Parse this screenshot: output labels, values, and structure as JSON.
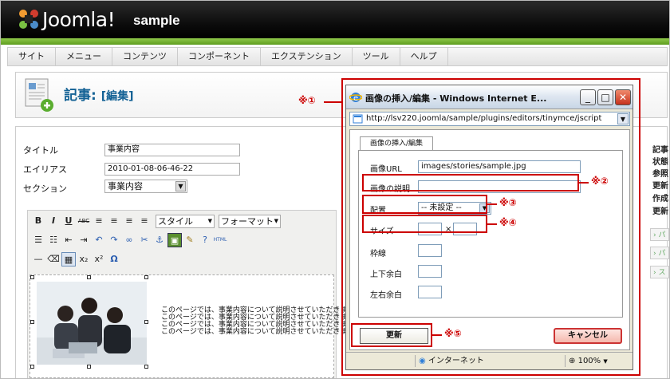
{
  "header": {
    "brand": "Joomla!",
    "site_name": "sample"
  },
  "menu": [
    "サイト",
    "メニュー",
    "コンテンツ",
    "コンポーネント",
    "エクステンション",
    "ツール",
    "ヘルプ"
  ],
  "page": {
    "title": "記事:",
    "subtitle": "[編集]"
  },
  "form": {
    "title_label": "タイトル",
    "title_value": "事業内容",
    "alias_label": "エイリアス",
    "alias_value": "2010-01-08-06-46-22",
    "section_label": "セクション",
    "section_value": "事業内容"
  },
  "editor": {
    "style_select": "スタイル",
    "format_select": "フォーマット",
    "body_lines": [
      "このページでは、事業内容について説明させていただきます。",
      "このページでは、事業内容について説明させていただきます。",
      "このページでは、事業内容について説明させていただきます。",
      "このページでは、事業内容について説明させていただきます。"
    ]
  },
  "right_panel": {
    "labels": [
      "記事",
      "状態",
      "参照",
      "更新",
      "作成",
      "更新"
    ],
    "buttons": [
      "パ",
      "パ",
      "ス"
    ]
  },
  "dialog": {
    "window_title": "画像の挿入/編集 - Windows Internet E...",
    "address": "http://lsv220.joomla/sample/plugins/editors/tinymce/jscript",
    "tab_label": "画像の挿入/編集",
    "url_label": "画像URL",
    "url_value": "images/stories/sample.jpg",
    "desc_label": "画像の説明",
    "desc_value": "",
    "align_label": "配置",
    "align_value": "-- 未設定 --",
    "size_label": "サイズ",
    "size_separator": "×",
    "border_label": "枠線",
    "vspace_label": "上下余白",
    "hspace_label": "左右余白",
    "update_button": "更新",
    "cancel_button": "キャンセル",
    "status_zone": "インターネット",
    "zoom": "100%"
  },
  "callouts": {
    "c1": "※①",
    "c2": "※②",
    "c3": "※③",
    "c4": "※④",
    "c5": "※⑤"
  },
  "colors": {
    "callout_red": "#cc0000",
    "joomla_green": "#6aa52a",
    "title_blue": "#146295"
  }
}
